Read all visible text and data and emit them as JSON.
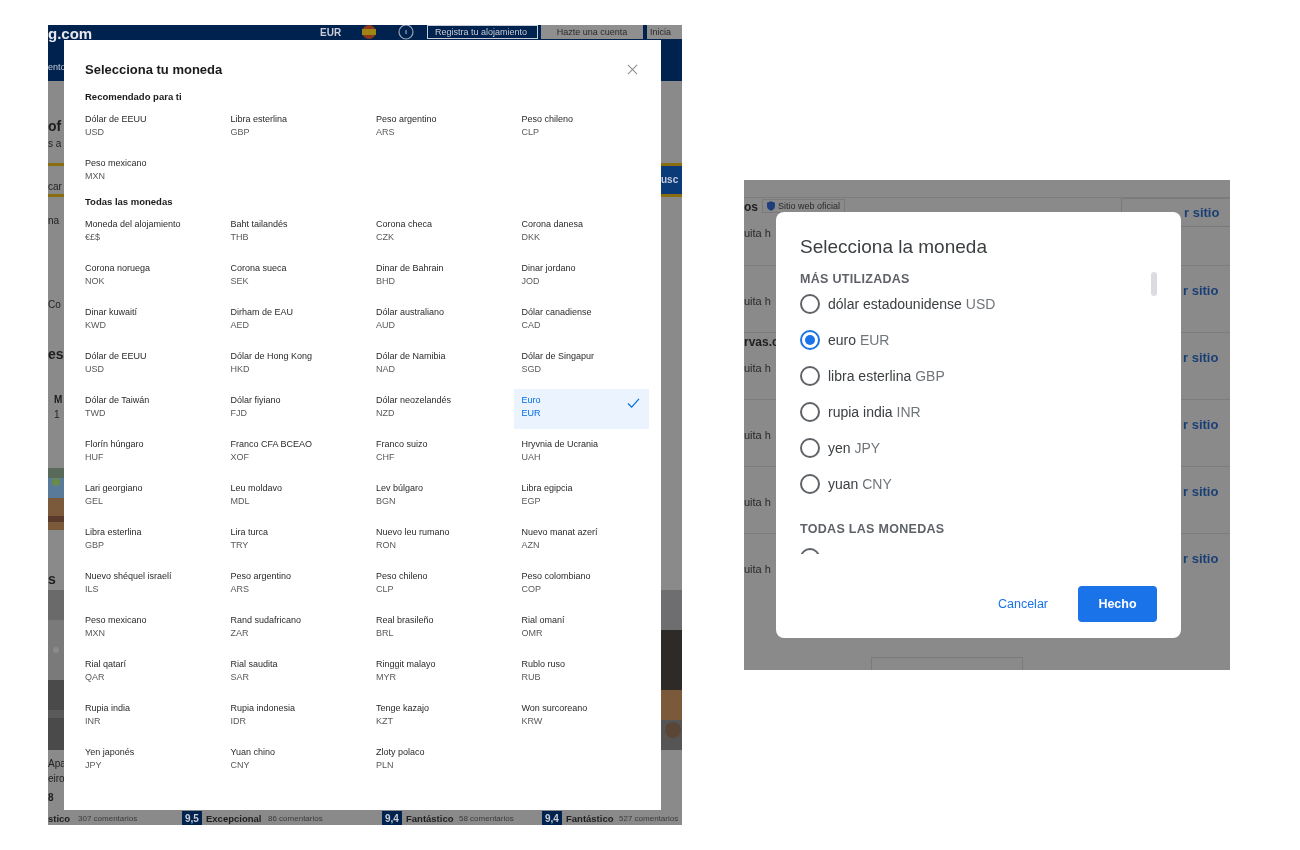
{
  "booking": {
    "background": {
      "logo": "g.com",
      "currency": "EUR",
      "buttons": [
        "Registra tu alojamiento",
        "Hazte una cuenta",
        "Inicia"
      ],
      "fragments": [
        {
          "kind": "nav",
          "text": "ento"
        },
        {
          "kind": "heading",
          "text": "of"
        },
        {
          "kind": "text",
          "text": "s a"
        },
        {
          "kind": "search",
          "text": "car"
        },
        {
          "kind": "text",
          "text": "na"
        },
        {
          "kind": "text",
          "text": "Co"
        },
        {
          "kind": "heading",
          "text": "es"
        },
        {
          "kind": "bold",
          "text": "M"
        },
        {
          "kind": "text",
          "text": "1"
        },
        {
          "kind": "heading",
          "text": "s"
        },
        {
          "kind": "text",
          "text": "Apa"
        },
        {
          "kind": "text",
          "text": "eiro"
        },
        {
          "kind": "bold",
          "text": "8"
        }
      ],
      "search_button": "usc",
      "ratings": [
        {
          "label": "stico",
          "reviews": "307 comentarios"
        },
        {
          "score": "9,5",
          "label": "Excepcional",
          "reviews": "86 comentarios"
        },
        {
          "score": "9,4",
          "label": "Fantástico",
          "reviews": "58 comentarios"
        },
        {
          "score": "9,4",
          "label": "Fantástico",
          "reviews": "527 comentarios"
        }
      ]
    },
    "modal": {
      "title": "Selecciona tu moneda",
      "recommended_heading": "Recomendado para ti",
      "recommended": [
        {
          "name": "Dólar de EEUU",
          "code": "USD",
          "selected": false
        },
        {
          "name": "Libra esterlina",
          "code": "GBP",
          "selected": false
        },
        {
          "name": "Peso argentino",
          "code": "ARS",
          "selected": false
        },
        {
          "name": "Peso chileno",
          "code": "CLP",
          "selected": false
        },
        {
          "name": "Peso mexicano",
          "code": "MXN",
          "selected": false
        }
      ],
      "all_heading": "Todas las monedas",
      "all": [
        {
          "name": "Moneda del alojamiento",
          "code": "€£$",
          "selected": false
        },
        {
          "name": "Baht tailandés",
          "code": "THB",
          "selected": false
        },
        {
          "name": "Corona checa",
          "code": "CZK",
          "selected": false
        },
        {
          "name": "Corona danesa",
          "code": "DKK",
          "selected": false
        },
        {
          "name": "Corona noruega",
          "code": "NOK",
          "selected": false
        },
        {
          "name": "Corona sueca",
          "code": "SEK",
          "selected": false
        },
        {
          "name": "Dinar de Bahrain",
          "code": "BHD",
          "selected": false
        },
        {
          "name": "Dinar jordano",
          "code": "JOD",
          "selected": false
        },
        {
          "name": "Dinar kuwaití",
          "code": "KWD",
          "selected": false
        },
        {
          "name": "Dirham de EAU",
          "code": "AED",
          "selected": false
        },
        {
          "name": "Dólar australiano",
          "code": "AUD",
          "selected": false
        },
        {
          "name": "Dólar canadiense",
          "code": "CAD",
          "selected": false
        },
        {
          "name": "Dólar de EEUU",
          "code": "USD",
          "selected": false
        },
        {
          "name": "Dólar de Hong Kong",
          "code": "HKD",
          "selected": false
        },
        {
          "name": "Dólar de Namibia",
          "code": "NAD",
          "selected": false
        },
        {
          "name": "Dólar de Singapur",
          "code": "SGD",
          "selected": false
        },
        {
          "name": "Dólar de Taiwán",
          "code": "TWD",
          "selected": false
        },
        {
          "name": "Dólar fiyiano",
          "code": "FJD",
          "selected": false
        },
        {
          "name": "Dólar neozelandés",
          "code": "NZD",
          "selected": false
        },
        {
          "name": "Euro",
          "code": "EUR",
          "selected": true
        },
        {
          "name": "Florín húngaro",
          "code": "HUF",
          "selected": false
        },
        {
          "name": "Franco CFA BCEAO",
          "code": "XOF",
          "selected": false
        },
        {
          "name": "Franco suizo",
          "code": "CHF",
          "selected": false
        },
        {
          "name": "Hryvnia de Ucrania",
          "code": "UAH",
          "selected": false
        },
        {
          "name": "Lari georgiano",
          "code": "GEL",
          "selected": false
        },
        {
          "name": "Leu moldavo",
          "code": "MDL",
          "selected": false
        },
        {
          "name": "Lev búlgaro",
          "code": "BGN",
          "selected": false
        },
        {
          "name": "Libra egipcia",
          "code": "EGP",
          "selected": false
        },
        {
          "name": "Libra esterlina",
          "code": "GBP",
          "selected": false
        },
        {
          "name": "Lira turca",
          "code": "TRY",
          "selected": false
        },
        {
          "name": "Nuevo leu rumano",
          "code": "RON",
          "selected": false
        },
        {
          "name": "Nuevo manat azerí",
          "code": "AZN",
          "selected": false
        },
        {
          "name": "Nuevo shéquel israelí",
          "code": "ILS",
          "selected": false
        },
        {
          "name": "Peso argentino",
          "code": "ARS",
          "selected": false
        },
        {
          "name": "Peso chileno",
          "code": "CLP",
          "selected": false
        },
        {
          "name": "Peso colombiano",
          "code": "COP",
          "selected": false
        },
        {
          "name": "Peso mexicano",
          "code": "MXN",
          "selected": false
        },
        {
          "name": "Rand sudafricano",
          "code": "ZAR",
          "selected": false
        },
        {
          "name": "Real brasileño",
          "code": "BRL",
          "selected": false
        },
        {
          "name": "Rial omaní",
          "code": "OMR",
          "selected": false
        },
        {
          "name": "Rial qatarí",
          "code": "QAR",
          "selected": false
        },
        {
          "name": "Rial saudita",
          "code": "SAR",
          "selected": false
        },
        {
          "name": "Ringgit malayo",
          "code": "MYR",
          "selected": false
        },
        {
          "name": "Rublo ruso",
          "code": "RUB",
          "selected": false
        },
        {
          "name": "Rupia india",
          "code": "INR",
          "selected": false
        },
        {
          "name": "Rupia indonesia",
          "code": "IDR",
          "selected": false
        },
        {
          "name": "Tenge kazajo",
          "code": "KZT",
          "selected": false
        },
        {
          "name": "Won surcoreano",
          "code": "KRW",
          "selected": false
        },
        {
          "name": "Yen japonés",
          "code": "JPY",
          "selected": false
        },
        {
          "name": "Yuan chino",
          "code": "CNY",
          "selected": false
        },
        {
          "name": "Zloty polaco",
          "code": "PLN",
          "selected": false
        }
      ]
    }
  },
  "google": {
    "background": {
      "rows": [
        {
          "title": "os",
          "badge": "Sitio web oficial",
          "subtitle": "uita h",
          "link": "r sitio"
        },
        {
          "subtitle": "uita h",
          "link": "r sitio"
        },
        {
          "title": "rvas.c",
          "subtitle": "uita h",
          "link": "r sitio"
        },
        {
          "subtitle": "uita h",
          "link": "r sitio"
        },
        {
          "subtitle": "uita h",
          "link": "r sitio"
        },
        {
          "subtitle": "uita h",
          "link": "r sitio"
        }
      ]
    },
    "dialog": {
      "title": "Selecciona la moneda",
      "frequent_heading": "MÁS UTILIZADAS",
      "options": [
        {
          "name": "dólar estadounidense",
          "code": "USD",
          "selected": false
        },
        {
          "name": "euro",
          "code": "EUR",
          "selected": true
        },
        {
          "name": "libra esterlina",
          "code": "GBP",
          "selected": false
        },
        {
          "name": "rupia india",
          "code": "INR",
          "selected": false
        },
        {
          "name": "yen",
          "code": "JPY",
          "selected": false
        },
        {
          "name": "yuan",
          "code": "CNY",
          "selected": false
        }
      ],
      "all_heading": "TODAS LAS MONEDAS",
      "all_options": [
        {
          "selected": false
        }
      ],
      "buttons": [
        "Cancelar",
        "Hecho"
      ]
    }
  }
}
